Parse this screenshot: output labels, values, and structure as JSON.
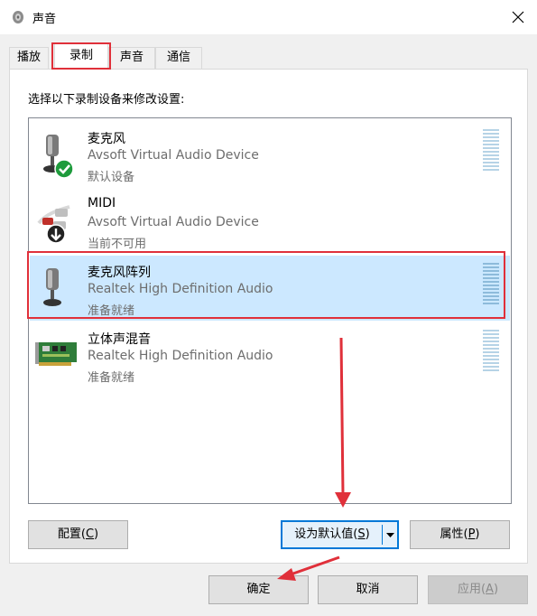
{
  "window": {
    "title": "声音",
    "close_icon": "close-icon"
  },
  "tabs": [
    {
      "label": "播放",
      "active": false
    },
    {
      "label": "录制",
      "active": true
    },
    {
      "label": "声音",
      "active": false
    },
    {
      "label": "通信",
      "active": false
    }
  ],
  "instruction": "选择以下录制设备来修改设置:",
  "devices": [
    {
      "name": "麦克风",
      "driver": "Avsoft Virtual Audio Device",
      "status": "默认设备",
      "icon": "microphone-default-icon",
      "selected": false
    },
    {
      "name": "MIDI",
      "driver": "Avsoft Virtual Audio Device",
      "status": "当前不可用",
      "icon": "rca-cable-unavailable-icon",
      "selected": false
    },
    {
      "name": "麦克风阵列",
      "driver": "Realtek High Definition Audio",
      "status": "准备就绪",
      "icon": "microphone-icon",
      "selected": true
    },
    {
      "name": "立体声混音",
      "driver": "Realtek High Definition Audio",
      "status": "准备就绪",
      "icon": "sound-card-icon",
      "selected": false
    }
  ],
  "buttons": {
    "configure": {
      "label": "配置",
      "key": "C"
    },
    "set_default": {
      "label": "设为默认值",
      "key": "S"
    },
    "properties": {
      "label": "属性",
      "key": "P"
    },
    "ok": "确定",
    "cancel": "取消",
    "apply": {
      "label": "应用",
      "key": "A"
    }
  },
  "colors": {
    "accent": "#0078d7",
    "selection": "#cce8ff",
    "annotation": "#e0303a"
  }
}
